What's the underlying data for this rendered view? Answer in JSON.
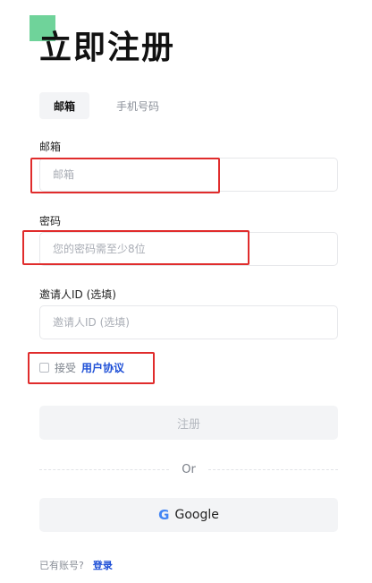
{
  "header": {
    "title": "立即注册"
  },
  "tabs": [
    {
      "label": "邮箱",
      "active": true
    },
    {
      "label": "手机号码",
      "active": false
    }
  ],
  "form": {
    "email": {
      "label": "邮箱",
      "placeholder": "邮箱",
      "value": ""
    },
    "password": {
      "label": "密码",
      "placeholder": "您的密码需至少8位",
      "value": ""
    },
    "invite": {
      "label": "邀请人ID (选填)",
      "placeholder": "邀请人ID (选填)",
      "value": ""
    },
    "agreement": {
      "prefix": "接受",
      "link": "用户协议",
      "checked": false
    }
  },
  "actions": {
    "register_label": "注册",
    "or_label": "Or",
    "google_icon": "G",
    "google_label": "Google"
  },
  "footer": {
    "has_account_text": "已有账号?",
    "login_link": "登录"
  },
  "colors": {
    "accent": "#6fd39a",
    "link": "#1e4fd6",
    "highlight": "#e02c2c"
  }
}
